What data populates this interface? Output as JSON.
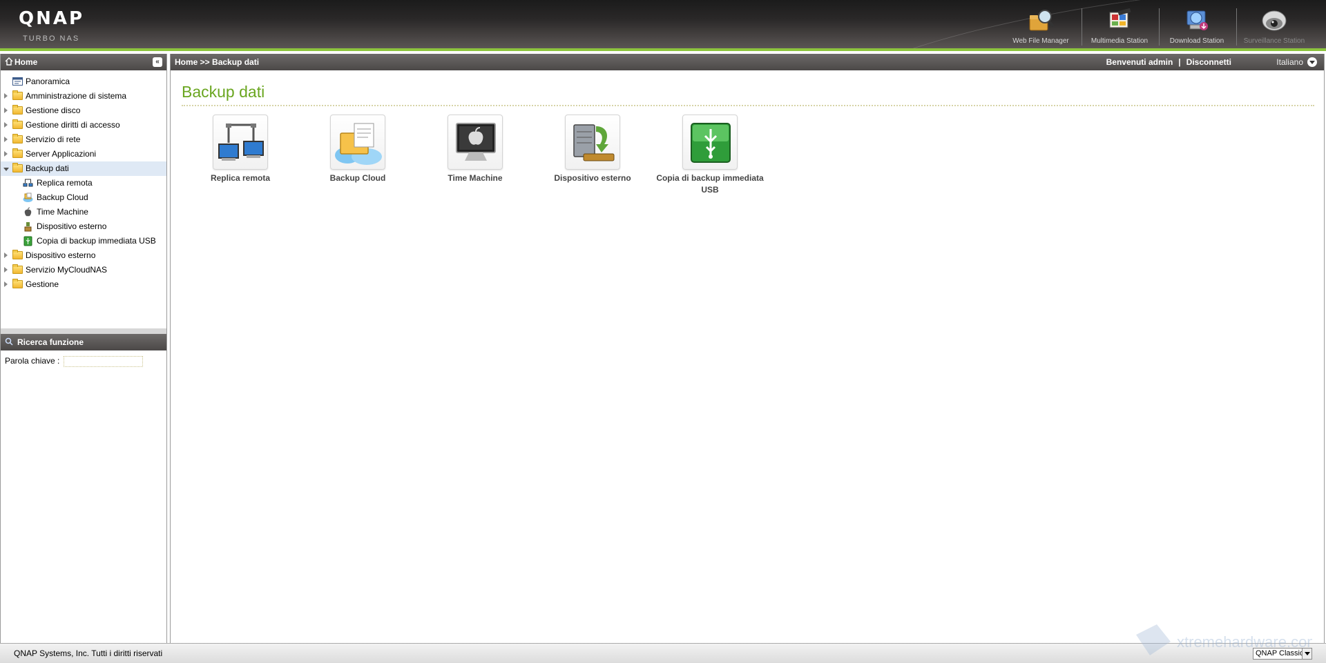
{
  "header": {
    "logo": "QNAP",
    "logo_sub": "TURBO NAS",
    "apps": [
      {
        "label": "Web File Manager",
        "icon": "magnifier-folder-icon"
      },
      {
        "label": "Multimedia Station",
        "icon": "multimedia-icon"
      },
      {
        "label": "Download Station",
        "icon": "download-globe-icon"
      },
      {
        "label": "Surveillance Station",
        "icon": "camera-icon"
      }
    ]
  },
  "sidebar": {
    "title": "Home",
    "items": [
      {
        "label": "Panoramica"
      },
      {
        "label": "Amministrazione di sistema"
      },
      {
        "label": "Gestione disco"
      },
      {
        "label": "Gestione diritti di accesso"
      },
      {
        "label": "Servizio di rete"
      },
      {
        "label": "Server Applicazioni"
      },
      {
        "label": "Backup dati"
      },
      {
        "label": "Replica remota"
      },
      {
        "label": "Backup Cloud"
      },
      {
        "label": "Time Machine"
      },
      {
        "label": "Dispositivo esterno"
      },
      {
        "label": "Copia di backup immediata USB"
      },
      {
        "label": "Dispositivo esterno"
      },
      {
        "label": "Servizio MyCloudNAS"
      },
      {
        "label": "Gestione"
      }
    ]
  },
  "search": {
    "title": "Ricerca funzione",
    "label": "Parola chiave :",
    "value": ""
  },
  "topbar": {
    "breadcrumb": "Home >> Backup dati",
    "welcome": "Benvenuti admin",
    "separator": "|",
    "logout": "Disconnetti",
    "language": "Italiano"
  },
  "main": {
    "title": "Backup dati",
    "tiles": [
      {
        "label": "Replica remota"
      },
      {
        "label": "Backup Cloud"
      },
      {
        "label": "Time Machine"
      },
      {
        "label": "Dispositivo esterno"
      },
      {
        "label": "Copia di backup immediata USB"
      }
    ]
  },
  "footer": {
    "copyright": "QNAP Systems, Inc. Tutti i diritti riservati",
    "theme": "QNAP Classic"
  },
  "watermark": "xtremehardware.com",
  "colors": {
    "accent": "#8cc43d",
    "title": "#6aa620",
    "header_dark": "#1b1b1b",
    "selected_row": "#dfe9f5"
  }
}
